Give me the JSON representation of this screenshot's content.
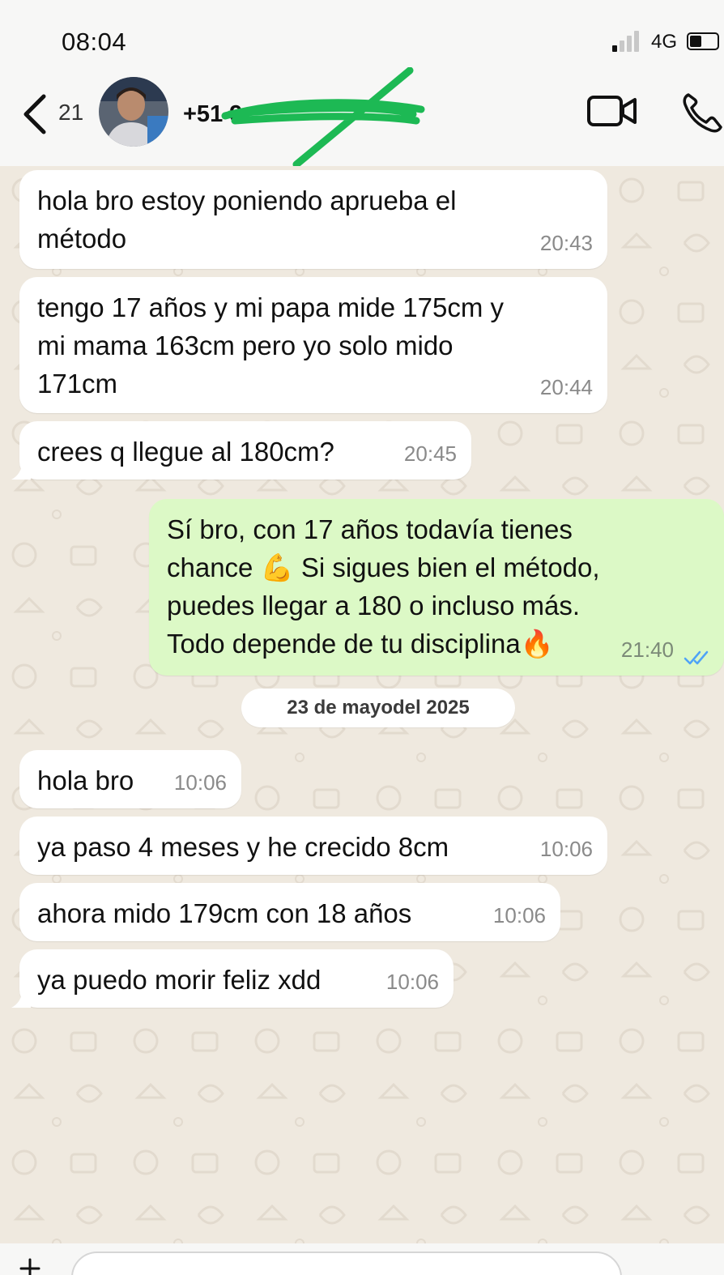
{
  "status_bar": {
    "time": "08:04",
    "network": "4G",
    "battery_level": 0.45
  },
  "header": {
    "back_count": "21",
    "contact_name": "+51 9"
  },
  "messages": [
    {
      "text": "hola bro estoy poniendo aprueba el\nmétodo",
      "time": "20:43",
      "direction": "in"
    },
    {
      "text": "tengo 17 años y mi papa mide 175cm y\nmi mama 163cm pero yo solo mido\n171cm",
      "time": "20:44",
      "direction": "in"
    },
    {
      "text": "crees q llegue al 180cm?",
      "time": "20:45",
      "direction": "in"
    },
    {
      "text": "Sí bro, con 17 años todavía tienes\nchance 💪 Si sigues bien el método,\npuedes llegar a 180 o incluso más.\nTodo depende de tu disciplina🔥",
      "time": "21:40",
      "direction": "out",
      "status": "read"
    },
    {
      "text": "hola bro",
      "time": "10:06",
      "direction": "in"
    },
    {
      "text": "ya paso 4 meses y he crecido 8cm",
      "time": "10:06",
      "direction": "in"
    },
    {
      "text": "ahora mido 179cm con 18 años",
      "time": "10:06",
      "direction": "in"
    },
    {
      "text": "ya puedo morir feliz xdd",
      "time": "10:06",
      "direction": "in"
    }
  ],
  "date_separator": "23 de mayodel 2025",
  "colors": {
    "incoming_bubble": "#ffffff",
    "outgoing_bubble": "#dcf9c6",
    "chat_background": "#efe9df",
    "read_ticks": "#4fa3f7",
    "redaction_scribble": "#1db954"
  },
  "icons": {
    "back": "chevron-left-icon",
    "video": "video-camera-icon",
    "call": "phone-icon",
    "read_status": "double-check-icon"
  }
}
